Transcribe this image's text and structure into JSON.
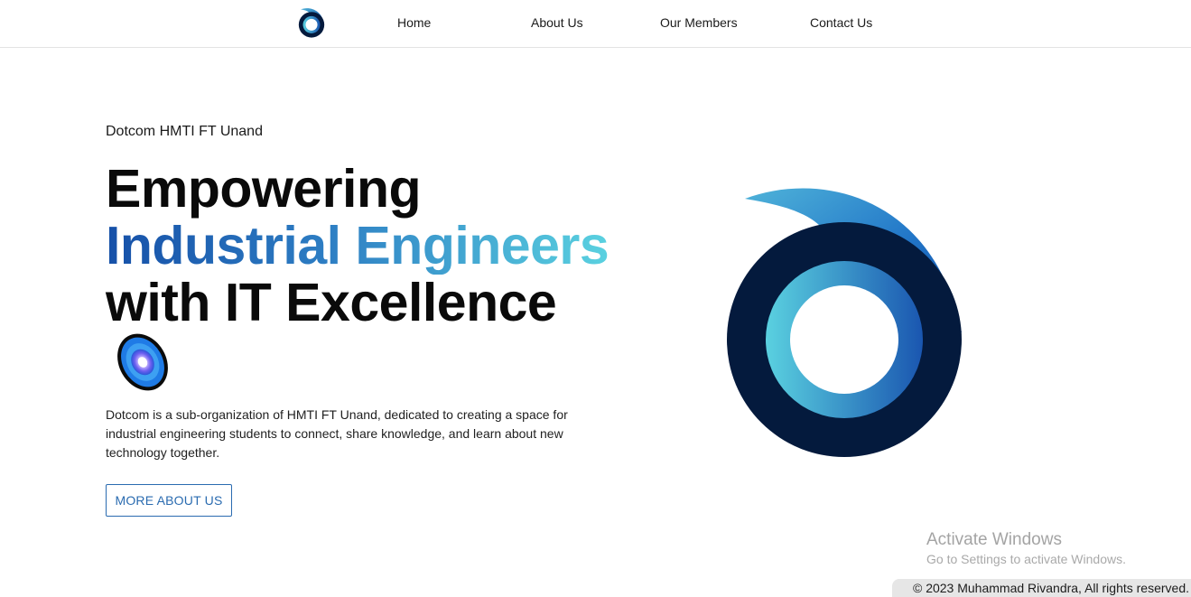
{
  "nav": {
    "links": [
      "Home",
      "About Us",
      "Our Members",
      "Contact Us"
    ]
  },
  "hero": {
    "eyebrow": "Dotcom HMTI FT Unand",
    "headline_line1": "Empowering",
    "headline_line2": "Industrial Engineers",
    "headline_line3": "with IT Excellence",
    "description": "Dotcom is a sub-organization of HMTI FT Unand, dedicated to creating a space for industrial engineering students to connect, share knowledge, and learn about new technology together.",
    "cta_label": "MORE ABOUT US",
    "emoji_icon": "planet-icon"
  },
  "brand": {
    "logo_icon": "dotcom-ring-logo-icon",
    "colors": {
      "navy": "#041a3d",
      "blue": "#1650a8",
      "cyan": "#5ad1e0",
      "button_text": "#2a6bb0"
    }
  },
  "watermark": {
    "title": "Activate Windows",
    "subtitle": "Go to Settings to activate Windows."
  },
  "footer": {
    "copyright": "© 2023 Muhammad Rivandra, All rights reserved."
  }
}
